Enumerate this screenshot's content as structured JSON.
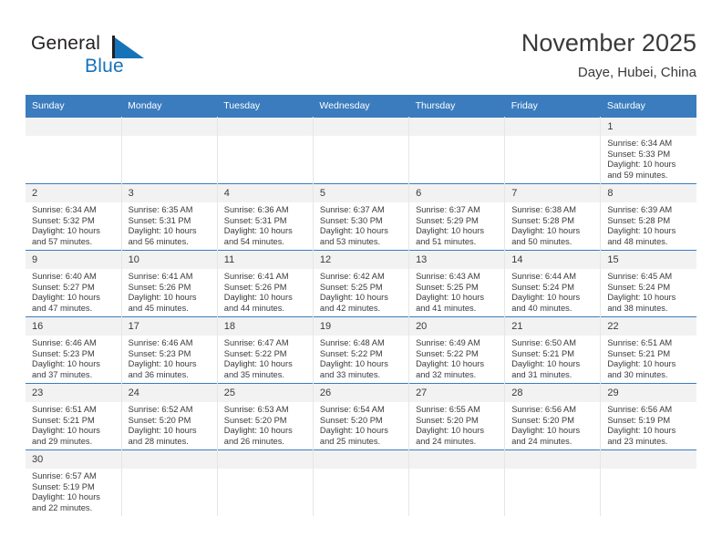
{
  "brand": {
    "name_part1": "General",
    "name_part2": "Blue",
    "flag_icon": "triangle-flag-icon",
    "accent_color": "#1673b9"
  },
  "header": {
    "title": "November 2025",
    "subtitle": "Daye, Hubei, China"
  },
  "theme": {
    "header_row_bg": "#3b7cbf",
    "daynum_bg": "#f2f2f2",
    "text_color": "#3a3a3a"
  },
  "calendar": {
    "weekday_headers": [
      "Sunday",
      "Monday",
      "Tuesday",
      "Wednesday",
      "Thursday",
      "Friday",
      "Saturday"
    ],
    "weeks": [
      [
        {
          "day": "",
          "empty": true,
          "sunrise": "",
          "sunset": "",
          "daylight_line1": "",
          "daylight_line2": ""
        },
        {
          "day": "",
          "empty": true,
          "sunrise": "",
          "sunset": "",
          "daylight_line1": "",
          "daylight_line2": ""
        },
        {
          "day": "",
          "empty": true,
          "sunrise": "",
          "sunset": "",
          "daylight_line1": "",
          "daylight_line2": ""
        },
        {
          "day": "",
          "empty": true,
          "sunrise": "",
          "sunset": "",
          "daylight_line1": "",
          "daylight_line2": ""
        },
        {
          "day": "",
          "empty": true,
          "sunrise": "",
          "sunset": "",
          "daylight_line1": "",
          "daylight_line2": ""
        },
        {
          "day": "",
          "empty": true,
          "sunrise": "",
          "sunset": "",
          "daylight_line1": "",
          "daylight_line2": ""
        },
        {
          "day": "1",
          "empty": false,
          "sunrise": "Sunrise: 6:34 AM",
          "sunset": "Sunset: 5:33 PM",
          "daylight_line1": "Daylight: 10 hours",
          "daylight_line2": "and 59 minutes."
        }
      ],
      [
        {
          "day": "2",
          "empty": false,
          "sunrise": "Sunrise: 6:34 AM",
          "sunset": "Sunset: 5:32 PM",
          "daylight_line1": "Daylight: 10 hours",
          "daylight_line2": "and 57 minutes."
        },
        {
          "day": "3",
          "empty": false,
          "sunrise": "Sunrise: 6:35 AM",
          "sunset": "Sunset: 5:31 PM",
          "daylight_line1": "Daylight: 10 hours",
          "daylight_line2": "and 56 minutes."
        },
        {
          "day": "4",
          "empty": false,
          "sunrise": "Sunrise: 6:36 AM",
          "sunset": "Sunset: 5:31 PM",
          "daylight_line1": "Daylight: 10 hours",
          "daylight_line2": "and 54 minutes."
        },
        {
          "day": "5",
          "empty": false,
          "sunrise": "Sunrise: 6:37 AM",
          "sunset": "Sunset: 5:30 PM",
          "daylight_line1": "Daylight: 10 hours",
          "daylight_line2": "and 53 minutes."
        },
        {
          "day": "6",
          "empty": false,
          "sunrise": "Sunrise: 6:37 AM",
          "sunset": "Sunset: 5:29 PM",
          "daylight_line1": "Daylight: 10 hours",
          "daylight_line2": "and 51 minutes."
        },
        {
          "day": "7",
          "empty": false,
          "sunrise": "Sunrise: 6:38 AM",
          "sunset": "Sunset: 5:28 PM",
          "daylight_line1": "Daylight: 10 hours",
          "daylight_line2": "and 50 minutes."
        },
        {
          "day": "8",
          "empty": false,
          "sunrise": "Sunrise: 6:39 AM",
          "sunset": "Sunset: 5:28 PM",
          "daylight_line1": "Daylight: 10 hours",
          "daylight_line2": "and 48 minutes."
        }
      ],
      [
        {
          "day": "9",
          "empty": false,
          "sunrise": "Sunrise: 6:40 AM",
          "sunset": "Sunset: 5:27 PM",
          "daylight_line1": "Daylight: 10 hours",
          "daylight_line2": "and 47 minutes."
        },
        {
          "day": "10",
          "empty": false,
          "sunrise": "Sunrise: 6:41 AM",
          "sunset": "Sunset: 5:26 PM",
          "daylight_line1": "Daylight: 10 hours",
          "daylight_line2": "and 45 minutes."
        },
        {
          "day": "11",
          "empty": false,
          "sunrise": "Sunrise: 6:41 AM",
          "sunset": "Sunset: 5:26 PM",
          "daylight_line1": "Daylight: 10 hours",
          "daylight_line2": "and 44 minutes."
        },
        {
          "day": "12",
          "empty": false,
          "sunrise": "Sunrise: 6:42 AM",
          "sunset": "Sunset: 5:25 PM",
          "daylight_line1": "Daylight: 10 hours",
          "daylight_line2": "and 42 minutes."
        },
        {
          "day": "13",
          "empty": false,
          "sunrise": "Sunrise: 6:43 AM",
          "sunset": "Sunset: 5:25 PM",
          "daylight_line1": "Daylight: 10 hours",
          "daylight_line2": "and 41 minutes."
        },
        {
          "day": "14",
          "empty": false,
          "sunrise": "Sunrise: 6:44 AM",
          "sunset": "Sunset: 5:24 PM",
          "daylight_line1": "Daylight: 10 hours",
          "daylight_line2": "and 40 minutes."
        },
        {
          "day": "15",
          "empty": false,
          "sunrise": "Sunrise: 6:45 AM",
          "sunset": "Sunset: 5:24 PM",
          "daylight_line1": "Daylight: 10 hours",
          "daylight_line2": "and 38 minutes."
        }
      ],
      [
        {
          "day": "16",
          "empty": false,
          "sunrise": "Sunrise: 6:46 AM",
          "sunset": "Sunset: 5:23 PM",
          "daylight_line1": "Daylight: 10 hours",
          "daylight_line2": "and 37 minutes."
        },
        {
          "day": "17",
          "empty": false,
          "sunrise": "Sunrise: 6:46 AM",
          "sunset": "Sunset: 5:23 PM",
          "daylight_line1": "Daylight: 10 hours",
          "daylight_line2": "and 36 minutes."
        },
        {
          "day": "18",
          "empty": false,
          "sunrise": "Sunrise: 6:47 AM",
          "sunset": "Sunset: 5:22 PM",
          "daylight_line1": "Daylight: 10 hours",
          "daylight_line2": "and 35 minutes."
        },
        {
          "day": "19",
          "empty": false,
          "sunrise": "Sunrise: 6:48 AM",
          "sunset": "Sunset: 5:22 PM",
          "daylight_line1": "Daylight: 10 hours",
          "daylight_line2": "and 33 minutes."
        },
        {
          "day": "20",
          "empty": false,
          "sunrise": "Sunrise: 6:49 AM",
          "sunset": "Sunset: 5:22 PM",
          "daylight_line1": "Daylight: 10 hours",
          "daylight_line2": "and 32 minutes."
        },
        {
          "day": "21",
          "empty": false,
          "sunrise": "Sunrise: 6:50 AM",
          "sunset": "Sunset: 5:21 PM",
          "daylight_line1": "Daylight: 10 hours",
          "daylight_line2": "and 31 minutes."
        },
        {
          "day": "22",
          "empty": false,
          "sunrise": "Sunrise: 6:51 AM",
          "sunset": "Sunset: 5:21 PM",
          "daylight_line1": "Daylight: 10 hours",
          "daylight_line2": "and 30 minutes."
        }
      ],
      [
        {
          "day": "23",
          "empty": false,
          "sunrise": "Sunrise: 6:51 AM",
          "sunset": "Sunset: 5:21 PM",
          "daylight_line1": "Daylight: 10 hours",
          "daylight_line2": "and 29 minutes."
        },
        {
          "day": "24",
          "empty": false,
          "sunrise": "Sunrise: 6:52 AM",
          "sunset": "Sunset: 5:20 PM",
          "daylight_line1": "Daylight: 10 hours",
          "daylight_line2": "and 28 minutes."
        },
        {
          "day": "25",
          "empty": false,
          "sunrise": "Sunrise: 6:53 AM",
          "sunset": "Sunset: 5:20 PM",
          "daylight_line1": "Daylight: 10 hours",
          "daylight_line2": "and 26 minutes."
        },
        {
          "day": "26",
          "empty": false,
          "sunrise": "Sunrise: 6:54 AM",
          "sunset": "Sunset: 5:20 PM",
          "daylight_line1": "Daylight: 10 hours",
          "daylight_line2": "and 25 minutes."
        },
        {
          "day": "27",
          "empty": false,
          "sunrise": "Sunrise: 6:55 AM",
          "sunset": "Sunset: 5:20 PM",
          "daylight_line1": "Daylight: 10 hours",
          "daylight_line2": "and 24 minutes."
        },
        {
          "day": "28",
          "empty": false,
          "sunrise": "Sunrise: 6:56 AM",
          "sunset": "Sunset: 5:20 PM",
          "daylight_line1": "Daylight: 10 hours",
          "daylight_line2": "and 24 minutes."
        },
        {
          "day": "29",
          "empty": false,
          "sunrise": "Sunrise: 6:56 AM",
          "sunset": "Sunset: 5:19 PM",
          "daylight_line1": "Daylight: 10 hours",
          "daylight_line2": "and 23 minutes."
        }
      ],
      [
        {
          "day": "30",
          "empty": false,
          "sunrise": "Sunrise: 6:57 AM",
          "sunset": "Sunset: 5:19 PM",
          "daylight_line1": "Daylight: 10 hours",
          "daylight_line2": "and 22 minutes."
        },
        {
          "day": "",
          "empty": true,
          "sunrise": "",
          "sunset": "",
          "daylight_line1": "",
          "daylight_line2": ""
        },
        {
          "day": "",
          "empty": true,
          "sunrise": "",
          "sunset": "",
          "daylight_line1": "",
          "daylight_line2": ""
        },
        {
          "day": "",
          "empty": true,
          "sunrise": "",
          "sunset": "",
          "daylight_line1": "",
          "daylight_line2": ""
        },
        {
          "day": "",
          "empty": true,
          "sunrise": "",
          "sunset": "",
          "daylight_line1": "",
          "daylight_line2": ""
        },
        {
          "day": "",
          "empty": true,
          "sunrise": "",
          "sunset": "",
          "daylight_line1": "",
          "daylight_line2": ""
        },
        {
          "day": "",
          "empty": true,
          "sunrise": "",
          "sunset": "",
          "daylight_line1": "",
          "daylight_line2": ""
        }
      ]
    ]
  }
}
